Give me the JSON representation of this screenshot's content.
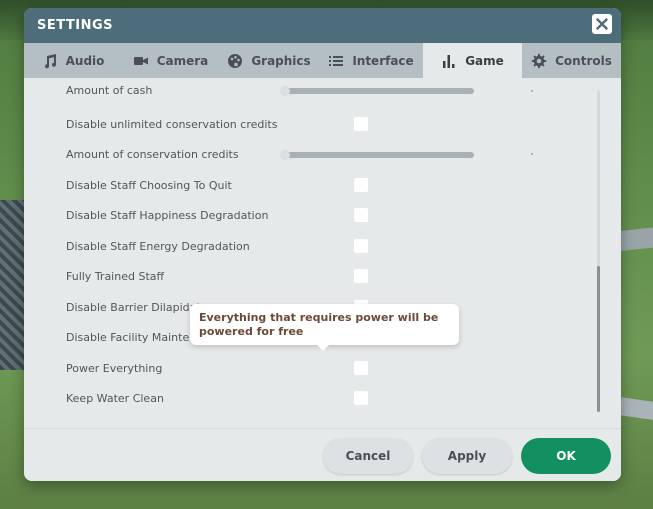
{
  "dialog": {
    "title": "SETTINGS"
  },
  "tabs": [
    {
      "label": "Audio",
      "icon": "music-note-icon",
      "active": false
    },
    {
      "label": "Camera",
      "icon": "video-camera-icon",
      "active": false
    },
    {
      "label": "Graphics",
      "icon": "palette-icon",
      "active": false
    },
    {
      "label": "Interface",
      "icon": "list-icon",
      "active": false
    },
    {
      "label": "Game",
      "icon": "bar-chart-icon",
      "active": true
    },
    {
      "label": "Controls",
      "icon": "gear-icon",
      "active": false
    }
  ],
  "settings": [
    {
      "label": "Amount of cash",
      "control": "slider",
      "value": 0
    },
    {
      "label": "Disable unlimited conservation credits",
      "control": "checkbox",
      "checked": false
    },
    {
      "label": "Amount of conservation credits",
      "control": "slider",
      "value": 0
    },
    {
      "label": "Disable Staff Choosing To Quit",
      "control": "checkbox",
      "checked": false
    },
    {
      "label": "Disable Staff Happiness Degradation",
      "control": "checkbox",
      "checked": false
    },
    {
      "label": "Disable Staff Energy Degradation",
      "control": "checkbox",
      "checked": false
    },
    {
      "label": "Fully Trained Staff",
      "control": "checkbox",
      "checked": false
    },
    {
      "label": "Disable Barrier Dilapidat",
      "control": "checkbox",
      "checked": false
    },
    {
      "label": "Disable Facility Maintena",
      "control": "checkbox",
      "checked": false
    },
    {
      "label": "Power Everything",
      "control": "checkbox",
      "checked": false
    },
    {
      "label": "Keep Water Clean",
      "control": "checkbox",
      "checked": false
    }
  ],
  "tooltip": {
    "text": "Everything that requires power will be powered for free"
  },
  "scrollbar": {
    "position": 0.55
  },
  "buttons": {
    "cancel": "Cancel",
    "apply": "Apply",
    "ok": "OK"
  },
  "colors": {
    "titlebar": "#4e6d7a",
    "tabbar": "#b4bfc4",
    "panel": "#e6e9ea",
    "ok_button": "#13905f",
    "tooltip_text": "#6b4a3a"
  }
}
